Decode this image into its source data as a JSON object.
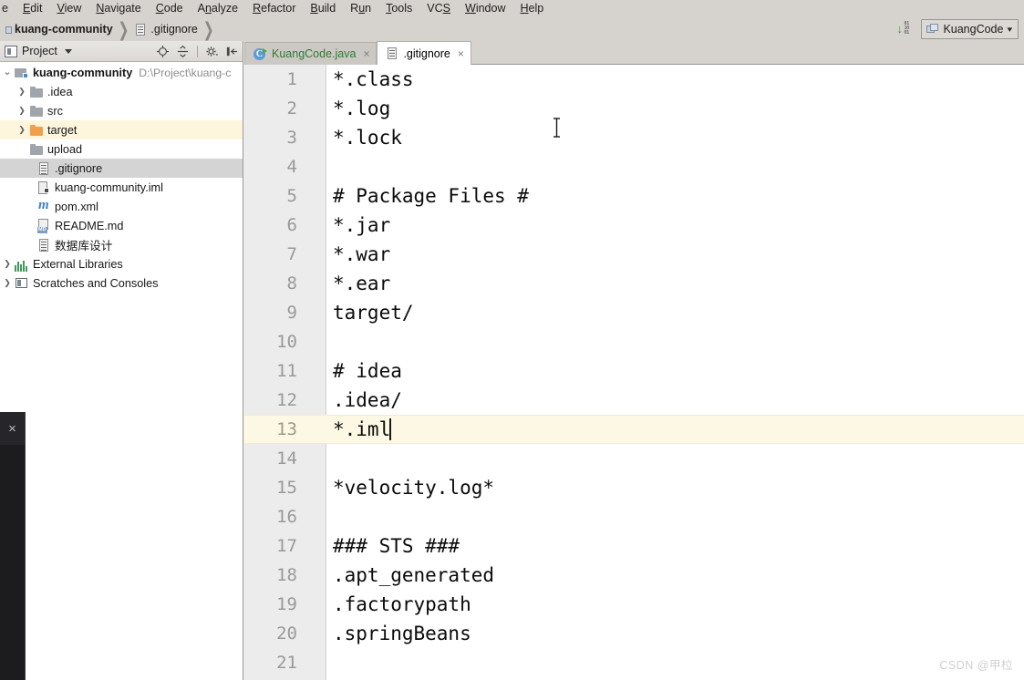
{
  "menu": {
    "items": [
      {
        "pre": "",
        "mn": "",
        "post": "e",
        "clipped": true
      },
      {
        "pre": "",
        "mn": "E",
        "post": "dit"
      },
      {
        "pre": "",
        "mn": "V",
        "post": "iew"
      },
      {
        "pre": "",
        "mn": "N",
        "post": "avigate"
      },
      {
        "pre": "",
        "mn": "C",
        "post": "ode"
      },
      {
        "pre": "A",
        "mn": "n",
        "post": "alyze"
      },
      {
        "pre": "",
        "mn": "R",
        "post": "efactor"
      },
      {
        "pre": "",
        "mn": "B",
        "post": "uild"
      },
      {
        "pre": "R",
        "mn": "u",
        "post": "n"
      },
      {
        "pre": "",
        "mn": "T",
        "post": "ools"
      },
      {
        "pre": "VC",
        "mn": "S",
        "post": ""
      },
      {
        "pre": "",
        "mn": "W",
        "post": "indow"
      },
      {
        "pre": "",
        "mn": "H",
        "post": "elp"
      }
    ]
  },
  "breadcrumb": {
    "project": "kuang-community",
    "file": ".gitignore",
    "separator": "❯",
    "binary_icon": "download-binary-icon",
    "binary_bits": [
      "01",
      "10",
      "01"
    ],
    "module_selector": {
      "label": "KuangCode",
      "icon": "module-icon",
      "caret": "⌄"
    }
  },
  "project_panel": {
    "title": "Project",
    "title_icon": "project-icon",
    "tools": [
      {
        "name": "locate-icon"
      },
      {
        "name": "collapse-all-icon"
      },
      {
        "name": "settings-gear-icon"
      },
      {
        "name": "hide-panel-icon"
      }
    ],
    "tree": [
      {
        "label": "kuang-community",
        "path": "D:\\Project\\kuang-c",
        "icon": "module-folder-icon",
        "arrow": "⌄",
        "depth": 0,
        "bold": true,
        "state": "expanded"
      },
      {
        "label": ".idea",
        "icon": "folder-icon",
        "arrow": "❯",
        "depth": 1,
        "state": "collapsed"
      },
      {
        "label": "src",
        "icon": "folder-icon",
        "arrow": "❯",
        "depth": 1,
        "state": "collapsed"
      },
      {
        "label": "target",
        "icon": "folder-icon-orange",
        "arrow": "❯",
        "depth": 1,
        "state": "collapsed",
        "highlight": true
      },
      {
        "label": "upload",
        "icon": "folder-icon",
        "arrow": "",
        "depth": 1
      },
      {
        "label": ".gitignore",
        "icon": "file-icon",
        "arrow": "",
        "depth": 2,
        "selected": true
      },
      {
        "label": "kuang-community.iml",
        "icon": "iml-file-icon",
        "arrow": "",
        "depth": 2
      },
      {
        "label": "pom.xml",
        "icon": "maven-icon",
        "arrow": "",
        "depth": 2
      },
      {
        "label": "README.md",
        "icon": "markdown-icon",
        "arrow": "",
        "depth": 2
      },
      {
        "label": "数据库设计",
        "icon": "file-icon",
        "arrow": "",
        "depth": 2
      },
      {
        "label": "External Libraries",
        "icon": "libraries-icon",
        "arrow": "❯",
        "depth": 0,
        "state": "collapsed"
      },
      {
        "label": "Scratches and Consoles",
        "icon": "scratches-icon",
        "arrow": "❯",
        "depth": 0,
        "state": "collapsed"
      }
    ]
  },
  "editor": {
    "tabs": [
      {
        "label": "KuangCode.java",
        "icon": "java-class-run-icon",
        "active": false,
        "close": "×",
        "label_color": "#2e7d32"
      },
      {
        "label": ".gitignore",
        "icon": "gitignore-file-icon",
        "active": true,
        "close": "×",
        "label_color": "#1b1b1b"
      }
    ],
    "filename": ".gitignore",
    "current_line": 13,
    "caret_after": "*.iml",
    "lines": [
      {
        "n": "1",
        "text": "*.class"
      },
      {
        "n": "2",
        "text": "*.log"
      },
      {
        "n": "3",
        "text": "*.lock"
      },
      {
        "n": "4",
        "text": ""
      },
      {
        "n": "5",
        "text": "# Package Files #"
      },
      {
        "n": "6",
        "text": "*.jar"
      },
      {
        "n": "7",
        "text": "*.war"
      },
      {
        "n": "8",
        "text": "*.ear"
      },
      {
        "n": "9",
        "text": "target/"
      },
      {
        "n": "10",
        "text": ""
      },
      {
        "n": "11",
        "text": "# idea"
      },
      {
        "n": "12",
        "text": ".idea/"
      },
      {
        "n": "13",
        "text": "*.iml",
        "current": true
      },
      {
        "n": "14",
        "text": ""
      },
      {
        "n": "15",
        "text": "*velocity.log*"
      },
      {
        "n": "16",
        "text": ""
      },
      {
        "n": "17",
        "text": "### STS ###"
      },
      {
        "n": "18",
        "text": ".apt_generated"
      },
      {
        "n": "19",
        "text": ".factorypath"
      },
      {
        "n": "20",
        "text": ".springBeans"
      },
      {
        "n": "21",
        "text": ""
      }
    ]
  },
  "overlay_panel": {
    "close_label": "×",
    "close_icon": "close-icon"
  },
  "watermark": "CSDN @甲柆",
  "colors": {
    "chrome": "#d6d2cd",
    "panel_bg": "#ffffff",
    "gutter": "#ececec",
    "current_line": "#fcf8e4",
    "selection": "#d4d4d4",
    "highlight_row": "#fdf6dd",
    "target_folder": "#f0a04b",
    "java_tab_text": "#2e7d32",
    "overlay": "#1c1c1e"
  }
}
